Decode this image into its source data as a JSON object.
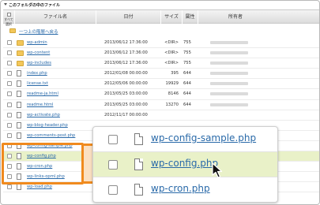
{
  "header": {
    "title": "このフォルダの中のファイル",
    "col_check": "すべて選択",
    "col_name": "ファイル名",
    "col_date": "日付",
    "col_size": "サイズ",
    "col_attr": "属性",
    "col_owner": "所有者"
  },
  "up_link": "一つ上の階層へ戻る",
  "files": [
    {
      "name": "wp-admin",
      "date": "2013/06/12 17:36:00",
      "size": "<DIR>",
      "attr": "755",
      "type": "folder"
    },
    {
      "name": "wp-content",
      "date": "2013/06/12 17:36:00",
      "size": "<DIR>",
      "attr": "755",
      "type": "folder"
    },
    {
      "name": "wp-includes",
      "date": "2013/06/12 17:36:00",
      "size": "<DIR>",
      "attr": "755",
      "type": "folder"
    },
    {
      "name": "index.php",
      "date": "2012/01/08 00:00:00",
      "size": "395",
      "attr": "644",
      "type": "file"
    },
    {
      "name": "license.txt",
      "date": "2012/05/06 00:00:00",
      "size": "19929",
      "attr": "644",
      "type": "file"
    },
    {
      "name": "readme-ja.html",
      "date": "2013/05/25 03:00:00",
      "size": "8146",
      "attr": "644",
      "type": "file"
    },
    {
      "name": "readme.html",
      "date": "2013/05/25 03:00:00",
      "size": "13270",
      "attr": "644",
      "type": "file"
    },
    {
      "name": "wp-activate.php",
      "date": "2012/11/17 00:00:00",
      "size": "",
      "attr": "",
      "type": "file"
    },
    {
      "name": "wp-blog-header.php",
      "date": "",
      "size": "",
      "attr": "",
      "type": "file"
    },
    {
      "name": "wp-comments-post.php",
      "date": "",
      "size": "",
      "attr": "",
      "type": "file"
    },
    {
      "name": "wp-config-sample.php",
      "date": "",
      "size": "",
      "attr": "",
      "type": "file"
    },
    {
      "name": "wp-config.php",
      "date": "",
      "size": "",
      "attr": "",
      "type": "file"
    },
    {
      "name": "wp-cron.php",
      "date": "",
      "size": "",
      "attr": "",
      "type": "file"
    },
    {
      "name": "wp-links-opml.php",
      "date": "",
      "size": "",
      "attr": "",
      "type": "file"
    },
    {
      "name": "wp-load.php",
      "date": "",
      "size": "",
      "attr": "",
      "type": "file"
    }
  ],
  "callout": {
    "items": [
      {
        "name": "wp-config-sample.php"
      },
      {
        "name": "wp-config.php"
      },
      {
        "name": "wp-cron.php"
      }
    ]
  },
  "colors": {
    "link": "#2a6aa9",
    "highlight": "#e9f1c8",
    "accent": "#f08a1e",
    "folder": "#f3c75a"
  }
}
